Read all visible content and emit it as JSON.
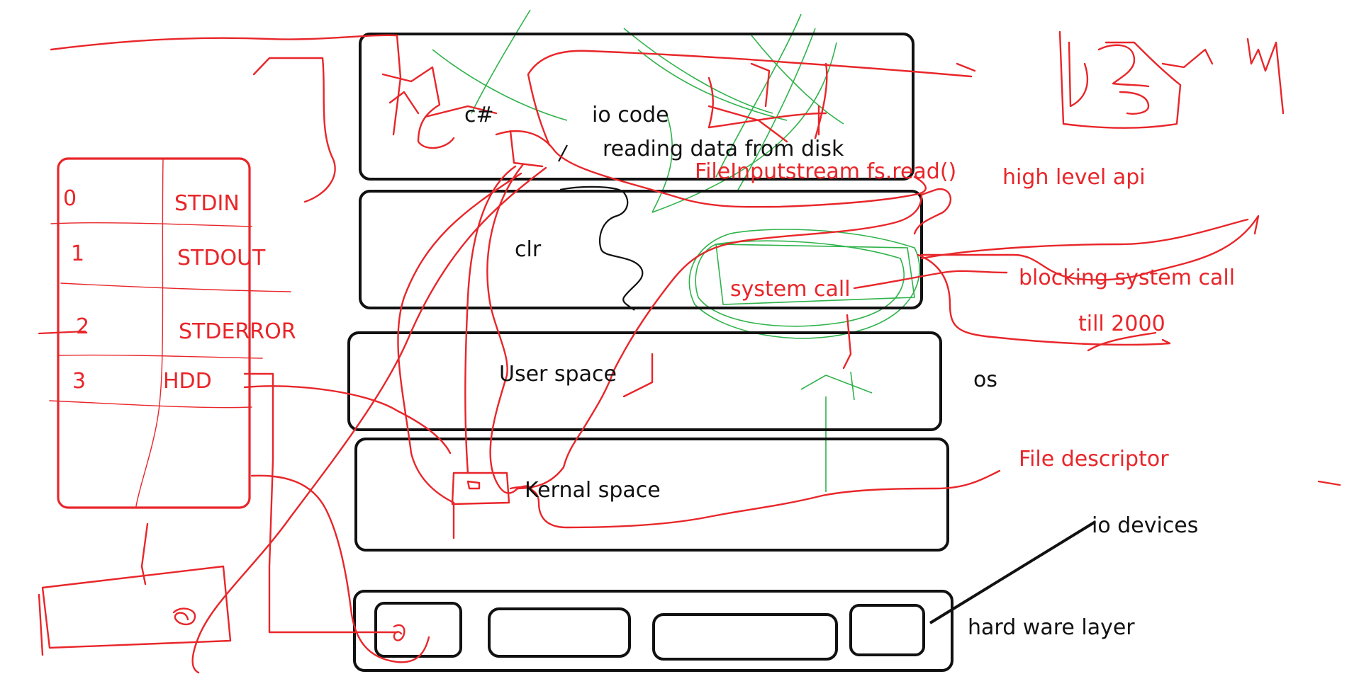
{
  "colors": {
    "black_ink": "#111111",
    "red_ink": "#e8262a",
    "green_ink": "#2fb34a"
  },
  "layers": {
    "app": {
      "lang": "c#",
      "title": "io code",
      "note": "reading data from disk"
    },
    "clr": {
      "label": "clr"
    },
    "user_space": {
      "label": "User space"
    },
    "kernel_space": {
      "label": "Kernal space"
    },
    "hardware": {
      "label": "hard ware layer"
    }
  },
  "side_labels": {
    "os": "os",
    "io_devices": "io devices"
  },
  "annotations": {
    "api_call": "FileInputstream fs.read()",
    "high_level_api": "high level api",
    "system_call": "system call",
    "blocking": "blocking system call",
    "till_2000": "till 2000",
    "file_descriptor": "File descriptor"
  },
  "fd_table": {
    "rows": [
      {
        "index": "0",
        "name": "STDIN"
      },
      {
        "index": "1",
        "name": "STDOUT"
      },
      {
        "index": "2",
        "name": "STDERROR"
      },
      {
        "index": "3",
        "name": "HDD"
      }
    ]
  }
}
